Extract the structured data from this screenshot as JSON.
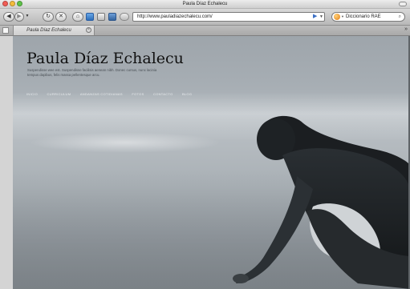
{
  "window": {
    "title": "Paula Díaz Echalecu"
  },
  "toolbar": {
    "back_symbol": "◀",
    "forward_symbol": "▶",
    "history_menu_symbol": "▼",
    "reload_symbol": "↻",
    "stop_symbol": "✕",
    "home_symbol": "⌂",
    "url": "http://www.pauladiazechalecu.com/",
    "go_symbol": "▶",
    "url_menu_symbol": "▼",
    "search_value": "Diccionario RAE",
    "search_symbol": "⌕",
    "icons": [
      "back-icon",
      "forward-icon",
      "reload-icon",
      "stop-icon",
      "home-icon",
      "bookmark-icon",
      "print-icon",
      "screenshot-icon",
      "plugin-icon",
      "go-icon",
      "search-engine-icon",
      "magnifier-icon"
    ]
  },
  "tabs": {
    "items": [
      {
        "label": "Paula Díaz Echalecu",
        "active": true
      }
    ],
    "close_symbol": "×",
    "list_symbol": "»"
  },
  "page": {
    "site_title": "Paula Díaz Echalecu",
    "tagline": "Suspendisse wee est. Suspendisse facilisis aenean nibh. Donec cursus, nunc lacinia tempus dapibus, felis massa pellentesque arcu.",
    "nav": [
      "INICIO",
      "CURRICULUM",
      "ANDANZAS COTIDIANAS",
      "FOTOS",
      "CONTACTO",
      "BLOG"
    ]
  },
  "colors": {
    "title_text": "#111111",
    "nav_text": "#e9ecee",
    "sea": "#a6adb3",
    "silhouette": "#1f2326"
  }
}
